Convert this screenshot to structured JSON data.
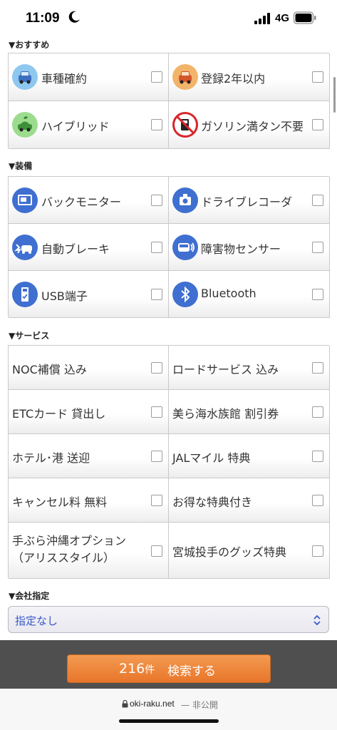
{
  "status_bar": {
    "time": "11:09",
    "network": "4G"
  },
  "sections": {
    "recommended": {
      "title": "▼おすすめ",
      "items": [
        {
          "label": "車種確約",
          "icon": "car-icon",
          "checked": false
        },
        {
          "label": "登録2年以内",
          "icon": "new-car-icon",
          "checked": false
        },
        {
          "label": "ハイブリッド",
          "icon": "hybrid-car-icon",
          "checked": false
        },
        {
          "label": "ガソリン満タン不要",
          "icon": "no-refuel-icon",
          "checked": false
        }
      ]
    },
    "equipment": {
      "title": "▼装備",
      "items": [
        {
          "label": "バックモニター",
          "icon": "back-monitor-icon",
          "checked": false
        },
        {
          "label": "ドライブレコーダ",
          "icon": "drive-recorder-icon",
          "checked": false
        },
        {
          "label": "自動ブレーキ",
          "icon": "auto-brake-icon",
          "checked": false
        },
        {
          "label": "障害物センサー",
          "icon": "obstacle-sensor-icon",
          "checked": false
        },
        {
          "label": "USB端子",
          "icon": "usb-icon",
          "checked": false
        },
        {
          "label": "Bluetooth",
          "icon": "bluetooth-icon",
          "checked": false
        }
      ]
    },
    "services": {
      "title": "▼サービス",
      "items": [
        {
          "label": "NOC補償 込み",
          "checked": false
        },
        {
          "label": "ロードサービス 込み",
          "checked": false
        },
        {
          "label": "ETCカード 貸出し",
          "checked": false
        },
        {
          "label": "美ら海水族館 割引券",
          "checked": false
        },
        {
          "label": "ホテル･港 送迎",
          "checked": false
        },
        {
          "label": "JALマイル 特典",
          "checked": false
        },
        {
          "label": "キャンセル料 無料",
          "checked": false
        },
        {
          "label": "お得な特典付き",
          "checked": false
        },
        {
          "label": "手ぶら沖縄オプション（アリススタイル）",
          "checked": false
        },
        {
          "label": "宮城投手のグッズ特典",
          "checked": false
        }
      ]
    },
    "company": {
      "title": "▼会社指定",
      "selected": "指定なし"
    }
  },
  "search": {
    "count": "216",
    "unit": "件",
    "label": "検索する"
  },
  "browser": {
    "url": "oki-raku.net",
    "separator": "— 非公開"
  },
  "colors": {
    "accent_orange": "#e8762a",
    "icon_blue": "#3f6fd0",
    "select_text": "#3a58c9"
  }
}
